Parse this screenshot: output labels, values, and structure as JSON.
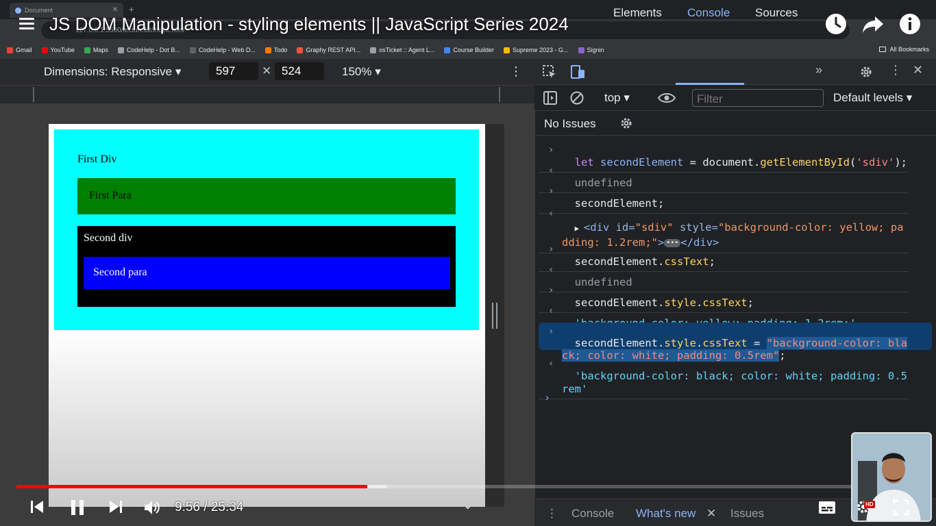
{
  "browser": {
    "tab_title": "Document",
    "url": "127.0.0.1:5500/lecture62/index.html",
    "bookmarks": [
      {
        "label": "Gmail",
        "color": "#ea4335"
      },
      {
        "label": "YouTube",
        "color": "#ff0000"
      },
      {
        "label": "Maps",
        "color": "#34a853"
      },
      {
        "label": "CodeHelp - Dot B...",
        "color": "#9aa0a6"
      },
      {
        "label": "CodeHelp - Web D...",
        "color": "#5f6368"
      },
      {
        "label": "Todo",
        "color": "#f57c00"
      },
      {
        "label": "Graphy REST API...",
        "color": "#e8553d"
      },
      {
        "label": "osTicket :: Agent L...",
        "color": "#9aa0a6"
      },
      {
        "label": "Course Builder",
        "color": "#4285f4"
      },
      {
        "label": "Supreme 2023 - G...",
        "color": "#fbbc04"
      },
      {
        "label": "Signin",
        "color": "#8a63d2"
      }
    ],
    "all_bookmarks": "All Bookmarks"
  },
  "video": {
    "title": "JS DOM Manipulation - styling elements || JavaScript Series 2024",
    "current_time": "9:56",
    "duration": "25:34",
    "time_display": "9:56 / 25:34",
    "progress_fraction": 0.3887,
    "hd_badge": "HD"
  },
  "device_toolbar": {
    "dimensions_label": "Dimensions: Responsive",
    "width": "597",
    "height": "524",
    "zoom": "150%"
  },
  "page": {
    "first_div": "First Div",
    "first_para": "First Para",
    "second_div": "Second div",
    "second_para": "Second para",
    "colors": {
      "first_div_bg": "#00ffff",
      "first_para_bg": "#008000",
      "second_div_bg": "#000000",
      "second_para_bg": "#0000ff"
    }
  },
  "devtools": {
    "tabs": [
      "Elements",
      "Console",
      "Sources"
    ],
    "active_tab": "Console",
    "context": "top",
    "filter_placeholder": "Filter",
    "levels": "Default levels",
    "issues": "No Issues",
    "drawer_tabs": [
      "Console",
      "What's new",
      "Issues"
    ],
    "drawer_active": "What's new"
  },
  "console": {
    "l1": {
      "kw": "let",
      "var": "secondElement",
      "mid": " = document.",
      "fn": "getElementById",
      "open": "(",
      "str": "'sdiv'",
      "close": ");"
    },
    "r1": "undefined",
    "l2": "secondElement;",
    "r2": {
      "open": "<div ",
      "a1": "id",
      "v1": "\"sdiv\"",
      "a2": "style",
      "v2": "\"background-color: yellow; padding: 1.2rem;\"",
      "close": "</div>"
    },
    "l3": {
      "obj": "secondElement.",
      "prop": "cssText",
      "end": ";"
    },
    "r3": "undefined",
    "l4": {
      "obj": "secondElement.",
      "p1": "style",
      "dot": ".",
      "p2": "cssText",
      "end": ";"
    },
    "r4": "'background-color: yellow; padding: 1.2rem;'",
    "l5": {
      "obj": "secondElement.",
      "p1": "style",
      "dot": ".",
      "p2": "cssText",
      "eq": " = ",
      "str": "\"background-color: black; color: white; padding: 0.5rem\"",
      "end": ";"
    },
    "r5": "'background-color: black; color: white; padding: 0.5rem'"
  }
}
